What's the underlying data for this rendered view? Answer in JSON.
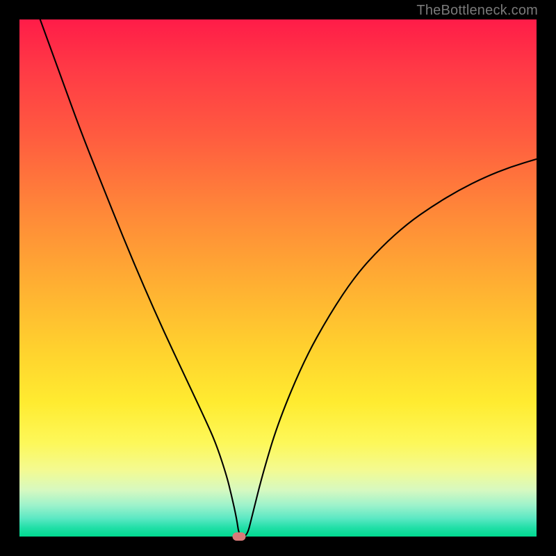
{
  "watermark": "TheBottleneck.com",
  "colors": {
    "frame": "#000000",
    "curve": "#000000",
    "marker": "#d97a79",
    "gradient_top": "#ff1c48",
    "gradient_bottom": "#00d98f"
  },
  "chart_data": {
    "type": "line",
    "title": "",
    "xlabel": "",
    "ylabel": "",
    "xlim": [
      0,
      100
    ],
    "ylim": [
      0,
      100
    ],
    "grid": false,
    "legend": false,
    "annotations": [],
    "marker": {
      "x": 42.5,
      "y": 0
    },
    "series": [
      {
        "name": "bottleneck-curve",
        "x": [
          4,
          8,
          12,
          16,
          20,
          24,
          28,
          32,
          36,
          38,
          40,
          41,
          42,
          42.5,
          44,
          45,
          47,
          50,
          55,
          60,
          65,
          70,
          75,
          80,
          85,
          90,
          95,
          100
        ],
        "y": [
          100,
          89,
          78,
          68,
          58,
          48.5,
          39.5,
          31,
          22.5,
          18,
          12,
          8,
          3.5,
          0,
          0,
          4,
          12,
          22,
          34,
          43,
          50.5,
          56,
          60.5,
          64,
          67,
          69.5,
          71.5,
          73
        ]
      }
    ]
  }
}
